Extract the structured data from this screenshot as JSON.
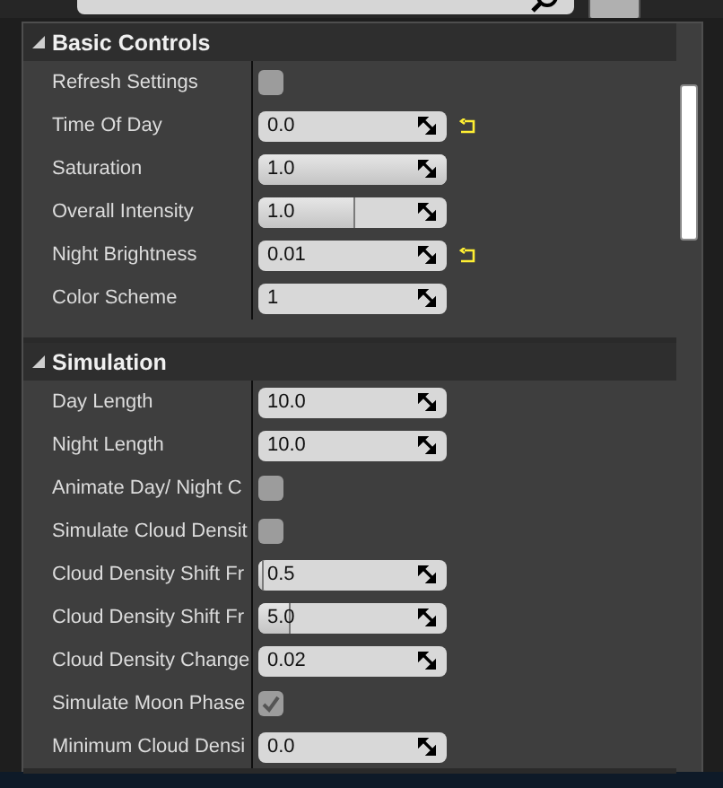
{
  "sections": [
    {
      "title": "Basic Controls",
      "expanded": true,
      "rows": [
        {
          "label": "Refresh Settings",
          "kind": "checkbox",
          "checked": false,
          "reset": false
        },
        {
          "label": "Time Of Day",
          "kind": "number",
          "value": "0.0",
          "reset": true
        },
        {
          "label": "Saturation",
          "kind": "slider",
          "value": "1.0",
          "level": 1,
          "reset": false
        },
        {
          "label": "Overall Intensity",
          "kind": "slider",
          "value": "1.0",
          "level": 0.5,
          "reset": false
        },
        {
          "label": "Night Brightness",
          "kind": "number",
          "value": "0.01",
          "reset": true
        },
        {
          "label": "Color Scheme",
          "kind": "number",
          "value": "1",
          "reset": false
        }
      ]
    },
    {
      "title": "Simulation",
      "expanded": true,
      "rows": [
        {
          "label": "Day Length",
          "kind": "number",
          "value": "10.0",
          "reset": false
        },
        {
          "label": "Night Length",
          "kind": "number",
          "value": "10.0",
          "reset": false
        },
        {
          "label": "Animate Day/ Night C",
          "kind": "checkbox",
          "checked": false,
          "reset": false
        },
        {
          "label": "Simulate Cloud Densit",
          "kind": "checkbox",
          "checked": false,
          "reset": false
        },
        {
          "label": "Cloud Density Shift Fr",
          "kind": "slider",
          "value": "0.5",
          "level": 0.02,
          "reset": false
        },
        {
          "label": "Cloud Density Shift Fr",
          "kind": "slider",
          "value": "5.0",
          "level": 0.16,
          "reset": false
        },
        {
          "label": "Cloud Density Change",
          "kind": "number",
          "value": "0.02",
          "reset": false
        },
        {
          "label": "Simulate Moon Phase",
          "kind": "checkbox",
          "checked": true,
          "reset": false
        },
        {
          "label": "Minimum Cloud Densi",
          "kind": "number",
          "value": "0.0",
          "reset": false
        }
      ]
    }
  ]
}
